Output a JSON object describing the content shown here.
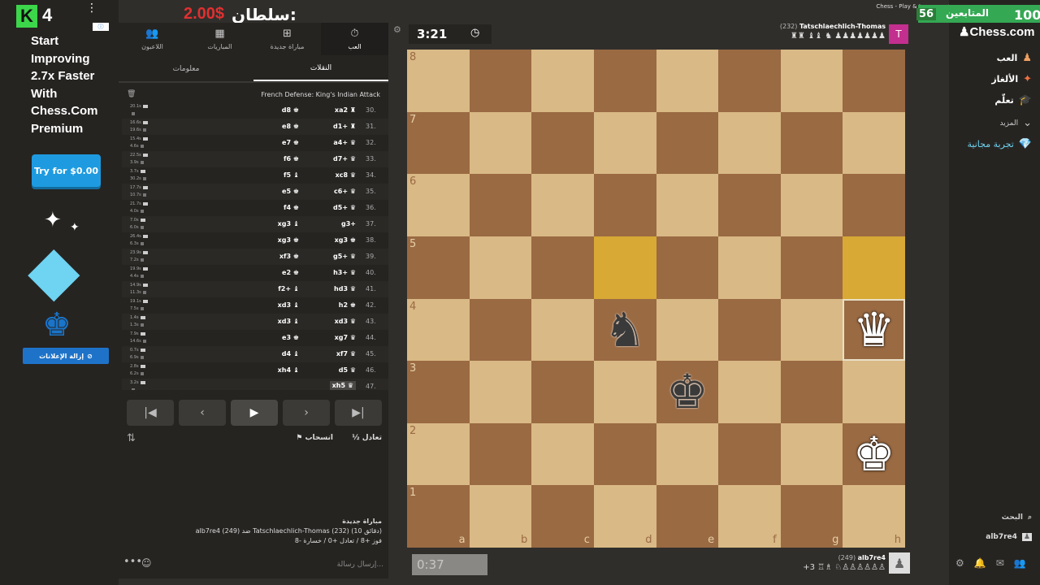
{
  "stream_overlay": {
    "kick_count": "4",
    "kick_logo": "K",
    "sultan_label": "سلطان:",
    "sultan_amount": "2.00$",
    "followers_label": "المتابعين",
    "followers_count": "100",
    "followers_small": "56"
  },
  "window_title": "Chess - Play & Learn - شطرنج لاعبين اثنين - Chess.com",
  "ad": {
    "promo_text": "Start Improving 2.7x Faster With Chess.Com Premium",
    "try_button": "Try for $0.00",
    "remove_ads": "إزالة الإعلانات"
  },
  "top_tabs": [
    {
      "label": "العب",
      "icon": "stopwatch-icon",
      "glyph": "⏱"
    },
    {
      "label": "مباراة جديدة",
      "icon": "plus-icon",
      "glyph": "⊞"
    },
    {
      "label": "المباريات",
      "icon": "board-icon",
      "glyph": "▦"
    },
    {
      "label": "اللاعبون",
      "icon": "players-icon",
      "glyph": "👥"
    }
  ],
  "sub_tabs": [
    {
      "label": "النقلات"
    },
    {
      "label": "معلومات"
    }
  ],
  "opening_name": "French Defense: King's Indian Attack",
  "moves": [
    {
      "n": "30.",
      "w": "xa2 ♜",
      "b": "d8 ♚",
      "tw": "20.1s",
      "tb": ""
    },
    {
      "n": "31.",
      "w": "d1+ ♜",
      "b": "e8 ♚",
      "tw": "16.6s",
      "tb": "19.6s"
    },
    {
      "n": "32.",
      "w": "a4+ ♛",
      "b": "e7 ♚",
      "tw": "15.4s",
      "tb": "4.6s"
    },
    {
      "n": "33.",
      "w": "d7+ ♛",
      "b": "f6 ♚",
      "tw": "22.5s",
      "tb": "3.9s"
    },
    {
      "n": "34.",
      "w": "xc8 ♛",
      "b": "f5 ♝",
      "tw": "3.7s",
      "tb": "30.2s"
    },
    {
      "n": "35.",
      "w": "c6+ ♛",
      "b": "e5 ♚",
      "tw": "17.7s",
      "tb": "10.7s"
    },
    {
      "n": "36.",
      "w": "d5+ ♛",
      "b": "f4 ♚",
      "tw": "21.7s",
      "tb": "4.0s"
    },
    {
      "n": "37.",
      "w": "g3+",
      "b": "xg3 ♝",
      "tw": "7.0s",
      "tb": "6.0s"
    },
    {
      "n": "38.",
      "w": "xg3 ♚",
      "b": "xg3 ♚",
      "tw": "26.4s",
      "tb": "6.3s"
    },
    {
      "n": "39.",
      "w": "g5+ ♛",
      "b": "xf3 ♚",
      "tw": "23.9s",
      "tb": "7.2s"
    },
    {
      "n": "40.",
      "w": "h3+ ♛",
      "b": "e2 ♚",
      "tw": "19.9s",
      "tb": "4.4s"
    },
    {
      "n": "41.",
      "w": "hd3 ♛",
      "b": "f2+ ♝",
      "tw": "14.9s",
      "tb": "11.3s"
    },
    {
      "n": "42.",
      "w": "h2 ♚",
      "b": "xd3 ♝",
      "tw": "19.1s",
      "tb": "7.5s"
    },
    {
      "n": "43.",
      "w": "xd3 ♛",
      "b": "xd3 ♝",
      "tw": "1.4s",
      "tb": "1.3s"
    },
    {
      "n": "44.",
      "w": "xg7 ♛",
      "b": "e3 ♚",
      "tw": "7.9s",
      "tb": "14.6s"
    },
    {
      "n": "45.",
      "w": "xf7 ♛",
      "b": "d4 ♝",
      "tw": "0.7s",
      "tb": "6.9s"
    },
    {
      "n": "46.",
      "w": "d5 ♛",
      "b": "xh4 ♝",
      "tw": "2.8s",
      "tb": "6.2s"
    },
    {
      "n": "47.",
      "w": "xh5 ♛",
      "b": "",
      "tw": "3.2s",
      "tb": ""
    }
  ],
  "controls": {
    "first": "|◀",
    "prev": "‹",
    "play": "▶",
    "next": "›",
    "last": "▶|",
    "draw": "½ تعادل",
    "resign": "⚑ انسحاب",
    "flip_icon": "⇅"
  },
  "game_info": {
    "title": "مباراة جديدة",
    "line1": "alb7re4 (249) ضد Tatschlaechlich-Thomas (232) (10 دقائق)",
    "line2": "فوز +8 / تعادل +0 / خسارة -8"
  },
  "chat": {
    "placeholder": "إرسال رسالة...",
    "more": "•••",
    "emoji": "☺"
  },
  "top_player": {
    "name": "Tatschlaechlich-Thomas",
    "rating": "(232)",
    "captured": "♜♜ ♝♝ ♞ ♟♟♟♟♟♟♟",
    "clock": "3:21",
    "avatar_letter": "T"
  },
  "bottom_player": {
    "name": "alb7re4",
    "rating": "(249)",
    "captured": "+3 ♖♗ ♘♙♙♙♙♙♙",
    "clock": "0:37"
  },
  "board": {
    "ranks": [
      "8",
      "7",
      "6",
      "5",
      "4",
      "3",
      "2",
      "1"
    ],
    "files": [
      "a",
      "b",
      "c",
      "d",
      "e",
      "f",
      "g",
      "h"
    ],
    "pieces": [
      {
        "sq": "d4",
        "glyph": "♞",
        "color": "black"
      },
      {
        "sq": "h4",
        "glyph": "♛",
        "color": "white"
      },
      {
        "sq": "e3",
        "glyph": "♚",
        "color": "black"
      },
      {
        "sq": "h2",
        "glyph": "♚",
        "color": "white"
      }
    ],
    "highlights": [
      "d5",
      "h5"
    ],
    "selected": [
      "h4"
    ]
  },
  "right_nav": {
    "logo": "♟Chess.com",
    "items": [
      {
        "label": "العب",
        "icon": "play-icon",
        "glyph": "♟"
      },
      {
        "label": "الألغاز",
        "icon": "puzzle-icon",
        "glyph": "✦"
      },
      {
        "label": "تعلّم",
        "icon": "learn-icon",
        "glyph": "🎓"
      },
      {
        "label": "المزيد",
        "icon": "chevron-down-icon",
        "glyph": "⌄"
      },
      {
        "label": "تجربة مجانية",
        "icon": "diamond-icon",
        "glyph": "💎"
      }
    ],
    "search": "البحث",
    "user": "alb7re4"
  },
  "colors": {
    "board_light": "#d9b985",
    "board_dark": "#9a6a43",
    "highlight": "#d8a935",
    "accent_green": "#34a853",
    "accent_blue": "#1e9be0"
  }
}
